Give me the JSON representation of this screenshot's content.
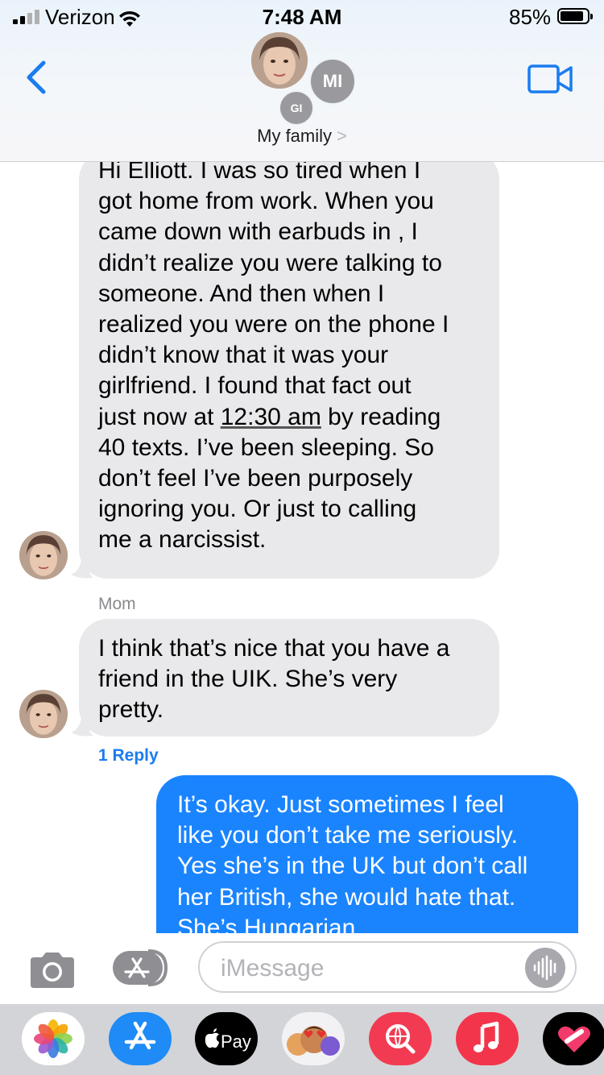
{
  "status_bar": {
    "carrier": "Verizon",
    "time": "7:48 AM",
    "battery_percent": "85%",
    "battery_level": 0.85,
    "signal_bars": 2
  },
  "header": {
    "back_icon": "chevron-left-icon",
    "video_icon": "video-camera-icon",
    "participants": [
      "MI",
      "GI"
    ],
    "group_name": "My family",
    "group_chevron": ">"
  },
  "messages": [
    {
      "direction": "incoming",
      "lines": [
        "Hi Elliott. I was so tired when I",
        "got home from work. When you",
        "came down with earbuds in , I",
        "didn’t realize you were talking to",
        "someone.  And then when I",
        "realized you were on the phone I",
        "didn’t know that it was your",
        "girlfriend. I found that fact out",
        "just now at ",
        "12:30 am",
        " by reading",
        "40 texts. I’ve been sleeping. So",
        "don’t feel I’ve been purposely",
        "ignoring you. Or just to calling",
        "me a narcissist."
      ]
    },
    {
      "direction": "incoming",
      "sender": "Mom",
      "lines": [
        "I think that’s nice that you have a",
        "friend in the UIK. She’s very",
        "pretty."
      ],
      "reply_link": "1 Reply"
    },
    {
      "direction": "outgoing",
      "lines": [
        "It’s okay. Just sometimes I feel",
        "like you don’t take me seriously.",
        "Yes she’s in the UK but don’t call",
        "her British, she would hate that.",
        "She’s Hungarian"
      ]
    }
  ],
  "input_bar": {
    "placeholder": "iMessage",
    "camera_icon": "camera-icon",
    "apps_icon": "app-store-icon",
    "audio_icon": "audio-waveform-icon"
  },
  "app_drawer": {
    "apps": [
      "photos-icon",
      "app-store-icon",
      "Pay",
      "memoji-icon",
      "web-search-icon",
      "music-icon",
      "heart-app-icon"
    ],
    "pay_label": "Pay"
  },
  "colors": {
    "imessage_blue": "#1a84ff",
    "incoming_gray": "#e9e9eb",
    "link_blue": "#1a7cf0",
    "ios_blue": "#1a7cf0"
  }
}
